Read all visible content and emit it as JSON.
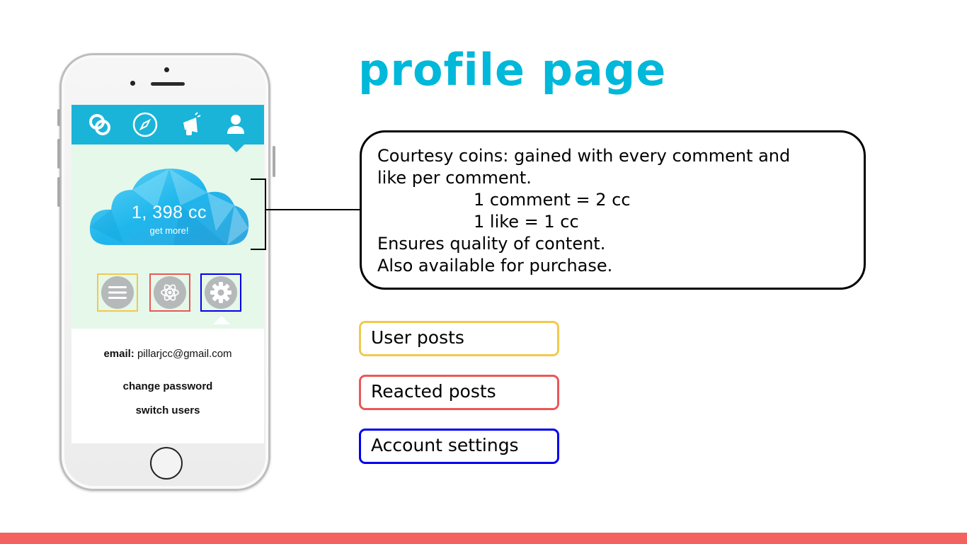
{
  "slide": {
    "title": "profile page"
  },
  "phone": {
    "nav": {
      "icons": [
        "link-rings-icon",
        "compass-icon",
        "megaphone-icon",
        "user-icon"
      ],
      "active": "user-icon"
    },
    "coins": {
      "value": "1, 398 cc",
      "action": "get more!"
    },
    "tabs": [
      {
        "icon": "list-icon",
        "border_color": "#f2c94c"
      },
      {
        "icon": "atom-icon",
        "border_color": "#eb5757"
      },
      {
        "icon": "gear-icon",
        "border_color": "#0000ee"
      }
    ],
    "account": {
      "email_label": "email:",
      "email_value": "pillarjcc@gmail.com",
      "change_password": "change password",
      "switch_users": "switch users"
    }
  },
  "callout": {
    "line1": "Courtesy coins: gained with every comment and",
    "line2": "like per comment.",
    "line3": "1 comment = 2 cc",
    "line4": "1 like = 1 cc",
    "line5": "Ensures quality of content.",
    "line6": "Also available for purchase."
  },
  "legend": [
    {
      "label": "User posts",
      "border_color": "#f2c94c"
    },
    {
      "label": "Reacted posts",
      "border_color": "#eb5757"
    },
    {
      "label": "Account settings",
      "border_color": "#0000ee"
    }
  ],
  "colors": {
    "title": "#00b8d9",
    "nav_bar": "#1ab4d8",
    "profile_background": "#e5f8ea",
    "bottom_bar": "#f4625f"
  }
}
